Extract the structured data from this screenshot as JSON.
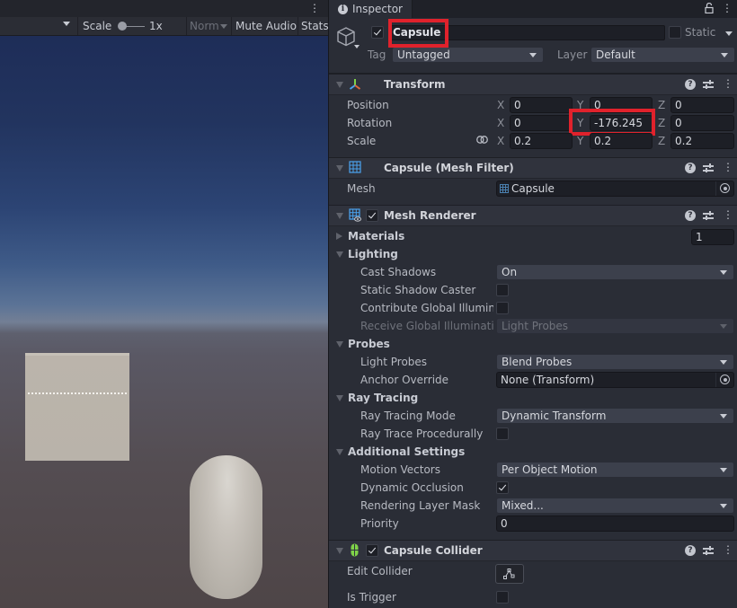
{
  "scene": {
    "toolbar": {
      "scale_label": "Scale",
      "scale_value": "1x",
      "scale_slider_fraction": 0.0,
      "aspect_dropdown": "Norm",
      "mute_audio_label": "Mute Audio",
      "stats_label": "Stats"
    },
    "objects": [
      "cube",
      "capsule"
    ]
  },
  "inspector": {
    "tab_label": "Inspector",
    "icons": {
      "tab": "info-icon",
      "lock": "lock-icon",
      "menu": "kebab-menu-icon"
    },
    "gameobject": {
      "active": true,
      "name": "Capsule",
      "static_label": "Static",
      "static": false,
      "tag_label": "Tag",
      "tag_value": "Untagged",
      "layer_label": "Layer",
      "layer_value": "Default"
    },
    "transform": {
      "title": "Transform",
      "position_label": "Position",
      "rotation_label": "Rotation",
      "scale_label": "Scale",
      "axis_x": "X",
      "axis_y": "Y",
      "axis_z": "Z",
      "position": {
        "x": "0",
        "y": "0",
        "z": "0"
      },
      "rotation": {
        "x": "0",
        "y": "-176.245",
        "z": "0"
      },
      "scale": {
        "x": "0.2",
        "y": "0.2",
        "z": "0.2"
      }
    },
    "mesh_filter": {
      "title": "Capsule (Mesh Filter)",
      "mesh_label": "Mesh",
      "mesh_value": "Capsule"
    },
    "mesh_renderer": {
      "title": "Mesh Renderer",
      "enabled": true,
      "materials_label": "Materials",
      "materials_count": "1",
      "lighting": {
        "label": "Lighting",
        "cast_shadows_label": "Cast Shadows",
        "cast_shadows_value": "On",
        "static_shadow_caster_label": "Static Shadow Caster",
        "static_shadow_caster": false,
        "contribute_gi_label": "Contribute Global Illuminat",
        "contribute_gi": false,
        "receive_gi_label": "Receive Global Illuminatior",
        "receive_gi_value": "Light Probes"
      },
      "probes": {
        "label": "Probes",
        "light_probes_label": "Light Probes",
        "light_probes_value": "Blend Probes",
        "anchor_override_label": "Anchor Override",
        "anchor_override_value": "None (Transform)"
      },
      "ray_tracing": {
        "label": "Ray Tracing",
        "mode_label": "Ray Tracing Mode",
        "mode_value": "Dynamic Transform",
        "procedural_label": "Ray Trace Procedurally",
        "procedural": false
      },
      "additional": {
        "label": "Additional Settings",
        "motion_vectors_label": "Motion Vectors",
        "motion_vectors_value": "Per Object Motion",
        "dynamic_occlusion_label": "Dynamic Occlusion",
        "dynamic_occlusion": true,
        "rendering_layer_mask_label": "Rendering Layer Mask",
        "rendering_layer_mask_value": "Mixed...",
        "priority_label": "Priority",
        "priority_value": "0"
      }
    },
    "capsule_collider": {
      "title": "Capsule Collider",
      "enabled": true,
      "edit_collider_label": "Edit Collider",
      "is_trigger_label": "Is Trigger",
      "is_trigger": false
    },
    "colors": {
      "highlight": "#e0222c",
      "collider_icon": "#7fd349",
      "mesh_icon": "#4aa3ef"
    }
  }
}
